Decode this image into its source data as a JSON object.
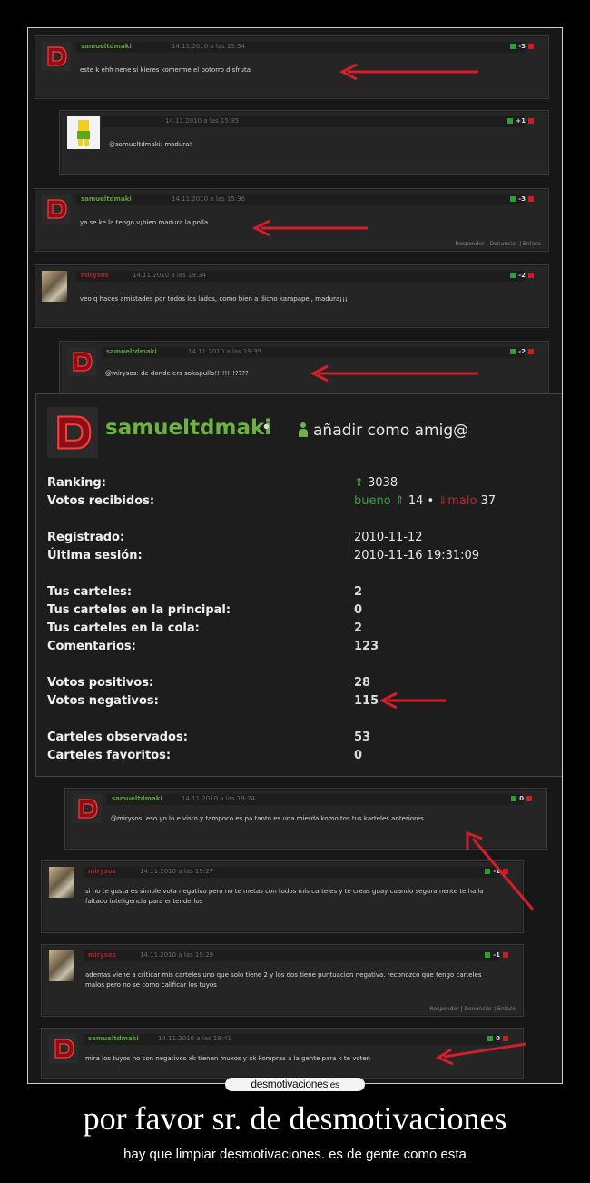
{
  "comments": [
    {
      "user": "samueltdmaki",
      "date": "14.11.2010 a las 15:34",
      "score": "-3",
      "text": "este k ehh nene si kieres komerme el potorro disfruta"
    },
    {
      "user": "",
      "date": "14.11.2010 a las 15:35",
      "score": "+1",
      "text": "@samueltdmaki: madura!"
    },
    {
      "user": "samueltdmaki",
      "date": "14.11.2010 a las 15:36",
      "score": "-3",
      "text": "ya se ke la tengo v¡bien madura la polla",
      "actions": "Responder  |  Denunciar  |  Enlace"
    },
    {
      "user": "mirysos",
      "date": "14.11.2010 a las 19:34",
      "score": "-2",
      "text": "veo q haces amistades por todos los lados, como bien a dicho karapapel, madura¡¡¡"
    },
    {
      "user": "samueltdmaki",
      "date": "14.11.2010 a las 19:35",
      "score": "-2",
      "text": "@mirysos: de donde ers sokapullo!!!!!!!!????"
    },
    {
      "user": "samueltdmaki",
      "date": "14.11.2010 a las 19:24",
      "score": "0",
      "text": "@mirysos: eso yo lo e visto y tampoco es pa tanto es una mierda komo tos tus karteles anteriores"
    },
    {
      "user": "mirysos",
      "date": "14.11.2010 a las 19:27",
      "score": "-1",
      "text": "si no te gusta es simple vota negativo pero no te metas con todos mis carteles y te creas guay cuando seguramente te halla faltado inteligencia para entenderlos"
    },
    {
      "user": "mirysos",
      "date": "14.11.2010 a las 19:29",
      "score": "-1",
      "text": "ademas viene a criticar mis carteles uno que solo tiene 2 y los dos tiene puntuacion negativa. reconozco que tengo carteles malos pero no se como calificar los tuyos",
      "actions": "Responder  |  Denunciar  |  Enlace"
    },
    {
      "user": "samueltdmaki",
      "date": "14.11.2010 a las 19:41",
      "score": "0",
      "text": "mira los tuyos no son negativos xk tienen muxos y xk kompras a la gente para k te voten"
    }
  ],
  "profile": {
    "username": "samueltdmaki",
    "dot": "•",
    "add_friend": "añadir como amig@",
    "ranking_label": "Ranking:",
    "ranking_arrow": "⇑",
    "ranking_value": "3038",
    "votos_recibidos_label": "Votos recibidos:",
    "bueno_label": "bueno ⇑",
    "bueno_value": "14",
    "sep": "•",
    "malo_label": "⇓malo",
    "malo_value": "37",
    "registrado_label": "Registrado:",
    "registrado_value": "2010-11-12",
    "ultima_label": "Última sesión:",
    "ultima_value": "2010-11-16 19:31:09",
    "tus_carteles_label": "Tus carteles:",
    "tus_carteles_value": "2",
    "principal_label": "Tus carteles en la principal:",
    "principal_value": "0",
    "cola_label": "Tus carteles en la cola:",
    "cola_value": "2",
    "comentarios_label": "Comentarios:",
    "comentarios_value": "123",
    "positivos_label": "Votos positivos:",
    "positivos_value": "28",
    "negativos_label": "Votos negativos:",
    "negativos_value": "115",
    "observados_label": "Carteles observados:",
    "observados_value": "53",
    "favoritos_label": "Carteles favoritos:",
    "favoritos_value": "0"
  },
  "logo": {
    "main": "desmotivaciones",
    "suffix": ".es"
  },
  "caption": {
    "title": "por favor sr. de desmotivaciones",
    "subtitle": "hay que limpiar desmotivaciones. es de gente como esta"
  },
  "colors": {
    "accent_green": "#6bb341",
    "arrow_red": "#d0202a",
    "background": "#000000"
  }
}
